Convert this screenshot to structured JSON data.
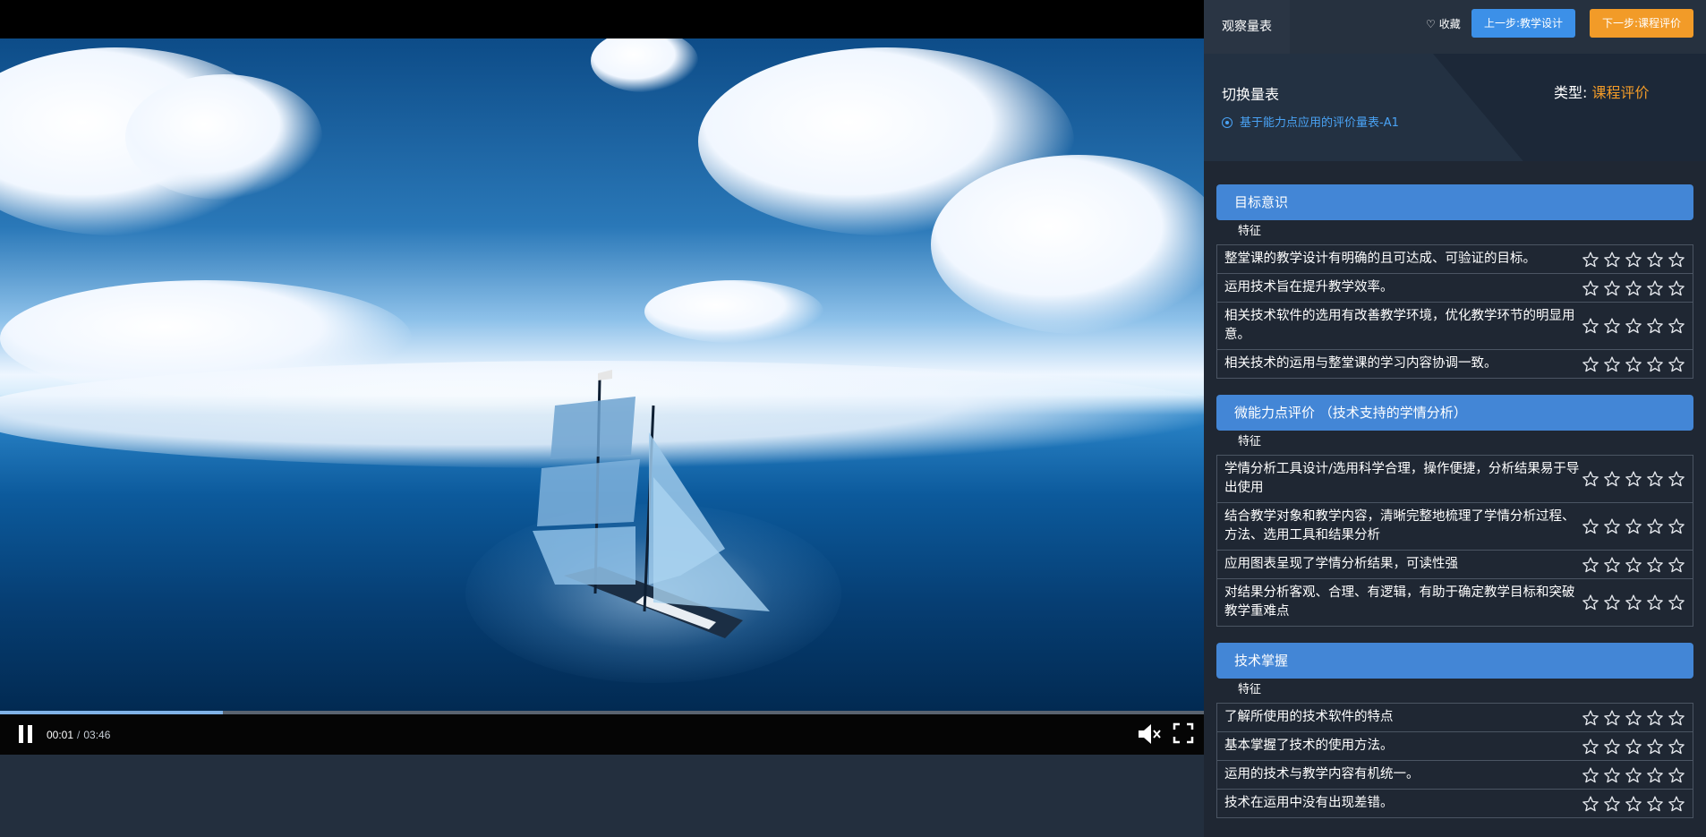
{
  "video": {
    "current_time": "00:01",
    "separator": "/",
    "total_time": "03:46",
    "progress_percent": 18.5
  },
  "panel": {
    "scale_tab_label": "观察量表",
    "favorite_label": "收藏",
    "prev_button": "上一步:教学设计",
    "next_button": "下一步:课程评价",
    "switch_scale_label": "切换量表",
    "scale_option": "基于能力点应用的评价量表-A1",
    "type_label": "类型:",
    "type_value": "课程评价"
  },
  "sections": [
    {
      "title": "目标意识",
      "feature_label": "特征",
      "items": [
        "整堂课的教学设计有明确的且可达成、可验证的目标。",
        "运用技术旨在提升教学效率。",
        "相关技术软件的选用有改善教学环境，优化教学环节的明显用意。",
        "相关技术的运用与整堂课的学习内容协调一致。"
      ]
    },
    {
      "title": "微能力点评价 （技术支持的学情分析）",
      "feature_label": "特征",
      "items": [
        "学情分析工具设计/选用科学合理，操作便捷，分析结果易于导出使用",
        "结合教学对象和教学内容，清晰完整地梳理了学情分析过程、方法、选用工具和结果分析",
        "应用图表呈现了学情分析结果，可读性强",
        "对结果分析客观、合理、有逻辑，有助于确定教学目标和突破教学重难点"
      ]
    },
    {
      "title": "技术掌握",
      "feature_label": "特征",
      "items": [
        "了解所使用的技术软件的特点",
        "基本掌握了技术的使用方法。",
        "运用的技术与教学内容有机统一。",
        "技术在运用中没有出现差错。"
      ]
    }
  ],
  "colors": {
    "accent_blue": "#3c90e8",
    "accent_orange": "#f29b28",
    "section_header": "#4386d6",
    "panel_bg": "#1f2733"
  },
  "icons": {
    "heart": "heart-icon",
    "star": "star-outline-icon",
    "pause": "pause-icon",
    "volume": "volume-mute-icon",
    "fullscreen": "fullscreen-icon"
  }
}
